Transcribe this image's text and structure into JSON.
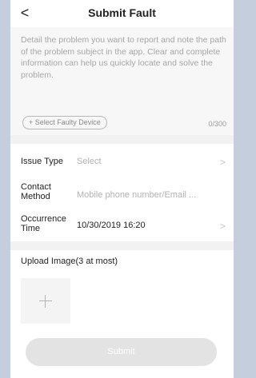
{
  "header": {
    "back_icon": "chevron-left-icon",
    "back_glyph": "<",
    "title": "Submit Fault"
  },
  "description": {
    "placeholder": "Detail the problem you want to report and note the path of the problem subject in the app. Clear and complete information can help us quickly locate and solve the problem.",
    "select_device_label": "+ Select Faulty Device",
    "char_count": "0/300"
  },
  "form": {
    "issue_type": {
      "label": "Issue Type",
      "value": "Select",
      "chevron": ">"
    },
    "contact_method": {
      "label_line1": "Contact",
      "label_line2": "Method",
      "value": "Mobile phone number/Email ..."
    },
    "occurrence_time": {
      "label_line1": "Occurrence",
      "label_line2": "Time",
      "value": "10/30/2019 16:20",
      "chevron": ">"
    }
  },
  "upload": {
    "title": "Upload Image(3 at most)",
    "add_icon": "plus-icon"
  },
  "actions": {
    "submit_label": "Submit"
  },
  "colors": {
    "background_outer": "#c4cedc",
    "section_gray": "#f7f7f7",
    "muted_text": "#a6a6a6",
    "submit_disabled": "#e3e3e3"
  }
}
